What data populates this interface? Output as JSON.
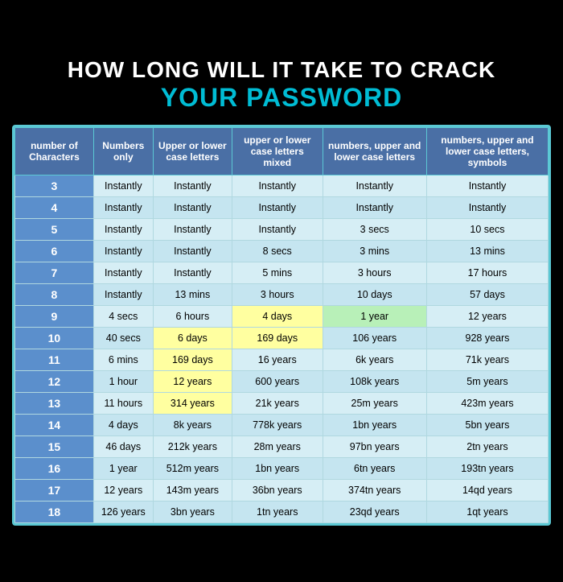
{
  "title": {
    "line1": "HOW LONG WILL IT TAKE TO CRACK",
    "line2": "YOUR PASSWORD"
  },
  "headers": [
    "number of Characters",
    "Numbers only",
    "Upper or lower case letters",
    "upper or lower case letters mixed",
    "numbers, upper and lower case letters",
    "numbers, upper and lower case letters, symbols"
  ],
  "rows": [
    {
      "num": "3",
      "c1": "Instantly",
      "c2": "Instantly",
      "c3": "Instantly",
      "c4": "Instantly",
      "c5": "Instantly",
      "h4": false,
      "h5": false,
      "hc4": "",
      "hc5": ""
    },
    {
      "num": "4",
      "c1": "Instantly",
      "c2": "Instantly",
      "c3": "Instantly",
      "c4": "Instantly",
      "c5": "Instantly",
      "h4": false,
      "h5": false,
      "hc4": "",
      "hc5": ""
    },
    {
      "num": "5",
      "c1": "Instantly",
      "c2": "Instantly",
      "c3": "Instantly",
      "c4": "3 secs",
      "c5": "10 secs",
      "h4": false,
      "h5": false,
      "hc4": "",
      "hc5": ""
    },
    {
      "num": "6",
      "c1": "Instantly",
      "c2": "Instantly",
      "c3": "8 secs",
      "c4": "3 mins",
      "c5": "13 mins",
      "h4": false,
      "h5": false,
      "hc4": "",
      "hc5": ""
    },
    {
      "num": "7",
      "c1": "Instantly",
      "c2": "Instantly",
      "c3": "5 mins",
      "c4": "3 hours",
      "c5": "17 hours",
      "h4": false,
      "h5": false,
      "hc4": "",
      "hc5": ""
    },
    {
      "num": "8",
      "c1": "Instantly",
      "c2": "13 mins",
      "c3": "3 hours",
      "c4": "10 days",
      "c5": "57 days",
      "h4": false,
      "h5": false,
      "hc4": "",
      "hc5": ""
    },
    {
      "num": "9",
      "c1": "4 secs",
      "c2": "6 hours",
      "c3": "4 days",
      "c4": "1 year",
      "c5": "12 years",
      "h4": true,
      "h5": true,
      "hc4": "yellow",
      "hc5": "green"
    },
    {
      "num": "10",
      "c1": "40 secs",
      "c2": "6 days",
      "c3": "169 days",
      "c4": "106 years",
      "c5": "928 years",
      "h4": false,
      "h5": false,
      "hc4": "",
      "hc5": "",
      "h3": true,
      "hc3": "yellow",
      "h2": true,
      "hc2": "yellow"
    },
    {
      "num": "11",
      "c1": "6 mins",
      "c2": "169 days",
      "c3": "16 years",
      "c4": "6k years",
      "c5": "71k years",
      "h4": false,
      "h5": false,
      "hc4": "",
      "hc5": "",
      "h2": true,
      "hc2": "yellow"
    },
    {
      "num": "12",
      "c1": "1 hour",
      "c2": "12 years",
      "c3": "600 years",
      "c4": "108k years",
      "c5": "5m years",
      "h4": false,
      "h5": false,
      "hc4": "",
      "hc5": "",
      "h2": true,
      "hc2": "yellow"
    },
    {
      "num": "13",
      "c1": "11 hours",
      "c2": "314 years",
      "c3": "21k years",
      "c4": "25m years",
      "c5": "423m years",
      "h4": false,
      "h5": false,
      "hc4": "",
      "hc5": "",
      "h2": true,
      "hc2": "yellow"
    },
    {
      "num": "14",
      "c1": "4 days",
      "c2": "8k years",
      "c3": "778k years",
      "c4": "1bn years",
      "c5": "5bn years",
      "h4": false,
      "h5": false,
      "hc4": "",
      "hc5": ""
    },
    {
      "num": "15",
      "c1": "46 days",
      "c2": "212k years",
      "c3": "28m years",
      "c4": "97bn years",
      "c5": "2tn years",
      "h4": false,
      "h5": false,
      "hc4": "",
      "hc5": ""
    },
    {
      "num": "16",
      "c1": "1 year",
      "c2": "512m years",
      "c3": "1bn years",
      "c4": "6tn years",
      "c5": "193tn years",
      "h4": false,
      "h5": false,
      "hc4": "",
      "hc5": ""
    },
    {
      "num": "17",
      "c1": "12 years",
      "c2": "143m years",
      "c3": "36bn years",
      "c4": "374tn years",
      "c5": "14qd years",
      "h4": false,
      "h5": false,
      "hc4": "",
      "hc5": ""
    },
    {
      "num": "18",
      "c1": "126 years",
      "c2": "3bn years",
      "c3": "1tn years",
      "c4": "23qd years",
      "c5": "1qt years",
      "h4": false,
      "h5": false,
      "hc4": "",
      "hc5": ""
    }
  ]
}
